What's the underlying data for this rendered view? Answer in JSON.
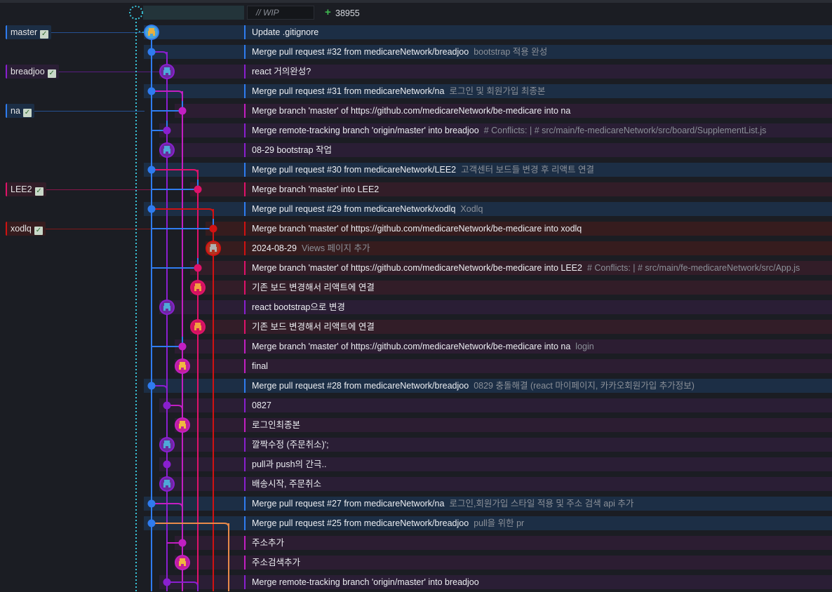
{
  "wip": {
    "placeholder": "// WIP",
    "plus": "+",
    "count": "38955"
  },
  "lane_colors": [
    "#2f7cf0",
    "#8a1fd0",
    "#c21fc2",
    "#e0126a",
    "#d11212",
    "#e88a4a"
  ],
  "lane_bg": [
    "#1c2e45",
    "#2a1e35",
    "#2c1d32",
    "#321d28",
    "#361c1e",
    "#362a22"
  ],
  "branches": [
    {
      "name": "master",
      "row": 0,
      "lane": 0,
      "check": "✓"
    },
    {
      "name": "breadjoo",
      "row": 2,
      "lane": 1,
      "check": "✓"
    },
    {
      "name": "na",
      "row": 4,
      "lane": 0,
      "check": "✓"
    },
    {
      "name": "LEE2",
      "row": 8,
      "lane": 3,
      "check": "✓"
    },
    {
      "name": "xodlq",
      "row": 10,
      "lane": 4,
      "check": "✓"
    }
  ],
  "commits": [
    {
      "lane": 0,
      "node": "avatar",
      "avatar": "a",
      "msg": "Update .gitignore",
      "desc": ""
    },
    {
      "lane": 0,
      "node": "dot",
      "msg": "Merge pull request #32 from medicareNetwork/breadjoo",
      "desc": "bootstrap 적용 완성"
    },
    {
      "lane": 1,
      "node": "avatar",
      "avatar": "b",
      "msg": "react 거의완성?",
      "desc": ""
    },
    {
      "lane": 0,
      "node": "dot",
      "msg": "Merge pull request #31 from medicareNetwork/na",
      "desc": "로그인 및 회원가입 최종본"
    },
    {
      "lane": 2,
      "node": "dot",
      "msg": "Merge branch 'master' of https://github.com/medicareNetwork/be-medicare into na",
      "desc": ""
    },
    {
      "lane": 1,
      "node": "dot",
      "msg": "Merge remote-tracking branch 'origin/master' into breadjoo",
      "desc": "# Conflicts: | # src/main/fe-medicareNetwork/src/board/SupplementList.js"
    },
    {
      "lane": 1,
      "node": "avatar",
      "avatar": "b",
      "msg": "08-29 bootstrap 작업",
      "desc": ""
    },
    {
      "lane": 0,
      "node": "dot",
      "msg": "Merge pull request #30 from medicareNetwork/LEE2",
      "desc": "고객센터 보드들 변경 후 리액트 연결"
    },
    {
      "lane": 3,
      "node": "dot",
      "msg": "Merge branch 'master' into LEE2",
      "desc": ""
    },
    {
      "lane": 0,
      "node": "dot",
      "msg": "Merge pull request #29 from medicareNetwork/xodlq",
      "desc": "Xodlq"
    },
    {
      "lane": 4,
      "node": "dot",
      "msg": "Merge branch 'master' of https://github.com/medicareNetwork/be-medicare into xodlq",
      "desc": ""
    },
    {
      "lane": 4,
      "node": "avatar",
      "avatar": "d",
      "msg": "2024-08-29",
      "desc": "Views 페이지 추가"
    },
    {
      "lane": 3,
      "node": "dot",
      "msg": "Merge branch 'master' of https://github.com/medicareNetwork/be-medicare into LEE2",
      "desc": "# Conflicts: | # src/main/fe-medicareNetwork/src/App.js"
    },
    {
      "lane": 3,
      "node": "avatar",
      "avatar": "c",
      "msg": "기존 보드 변경해서 리액트에 연결",
      "desc": ""
    },
    {
      "lane": 1,
      "node": "avatar",
      "avatar": "b",
      "msg": "react bootstrap으로 변경",
      "desc": ""
    },
    {
      "lane": 3,
      "node": "avatar",
      "avatar": "c",
      "msg": "기존 보드 변경해서 리액트에 연결",
      "desc": ""
    },
    {
      "lane": 2,
      "node": "dot",
      "msg": "Merge branch 'master' of https://github.com/medicareNetwork/be-medicare into na",
      "desc": "login"
    },
    {
      "lane": 2,
      "node": "avatar",
      "avatar": "e",
      "msg": "final",
      "desc": ""
    },
    {
      "lane": 0,
      "node": "dot",
      "msg": "Merge pull request #28 from medicareNetwork/breadjoo",
      "desc": "0829 충돌해결 (react 마이페이지, 카카오회원가입 추가정보)"
    },
    {
      "lane": 1,
      "node": "dot",
      "msg": "0827",
      "desc": ""
    },
    {
      "lane": 2,
      "node": "avatar",
      "avatar": "e",
      "msg": "로그인최종본",
      "desc": ""
    },
    {
      "lane": 1,
      "node": "avatar",
      "avatar": "b",
      "msg": "깔짝수정 (주문취소)';",
      "desc": ""
    },
    {
      "lane": 1,
      "node": "dot",
      "msg": "pull과 push의 간극..",
      "desc": ""
    },
    {
      "lane": 1,
      "node": "avatar",
      "avatar": "b",
      "msg": "배송시작, 주문취소",
      "desc": ""
    },
    {
      "lane": 0,
      "node": "dot",
      "msg": "Merge pull request #27 from medicareNetwork/na",
      "desc": "로그인,회원가입 스타일 적용 및 주소 검색 api 추가"
    },
    {
      "lane": 0,
      "node": "dot",
      "msg": "Merge pull request #25 from medicareNetwork/breadjoo",
      "desc": "pull을 위한 pr"
    },
    {
      "lane": 2,
      "node": "dot",
      "msg": "주소추가",
      "desc": ""
    },
    {
      "lane": 2,
      "node": "avatar",
      "avatar": "e",
      "msg": "주소검색추가",
      "desc": ""
    },
    {
      "lane": 1,
      "node": "dot",
      "msg": "Merge remote-tracking branch 'origin/master' into breadjoo",
      "desc": ""
    }
  ]
}
